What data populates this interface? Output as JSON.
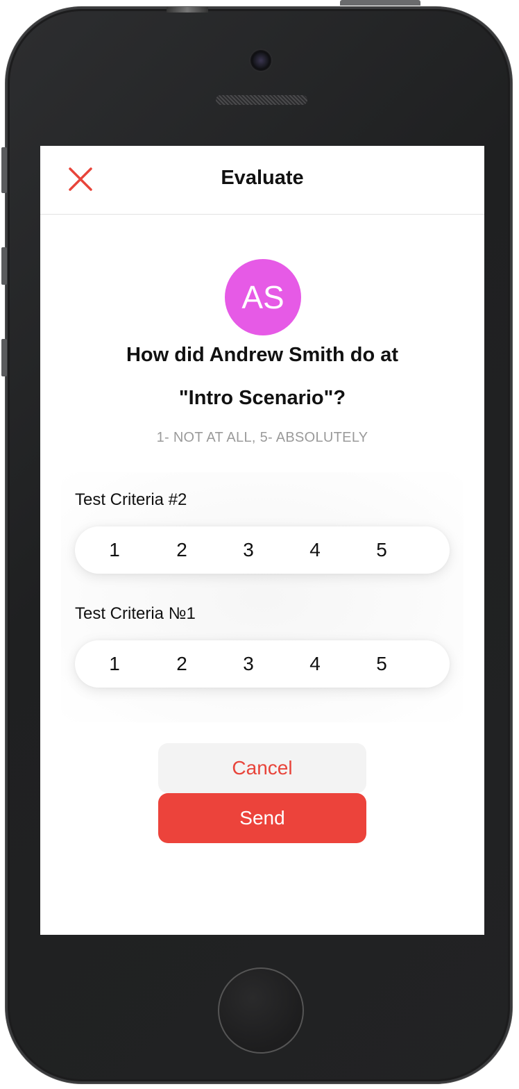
{
  "header": {
    "title": "Evaluate",
    "close_icon": "close-icon"
  },
  "colors": {
    "accent": "#ec433b",
    "avatar_bg": "#e65ae6",
    "hint_text": "#9a9a9a"
  },
  "evaluatee": {
    "initials": "AS",
    "question_line1": "How did Andrew Smith do at",
    "question_line2": "\"Intro Scenario\"?",
    "scale_hint": "1- NOT AT ALL, 5- ABSOLUTELY"
  },
  "criteria": [
    {
      "label": "Test Criteria #2",
      "options": [
        "1",
        "2",
        "3",
        "4",
        "5"
      ]
    },
    {
      "label": "Test Criteria №1",
      "options": [
        "1",
        "2",
        "3",
        "4",
        "5"
      ]
    }
  ],
  "actions": {
    "cancel_label": "Cancel",
    "send_label": "Send"
  }
}
